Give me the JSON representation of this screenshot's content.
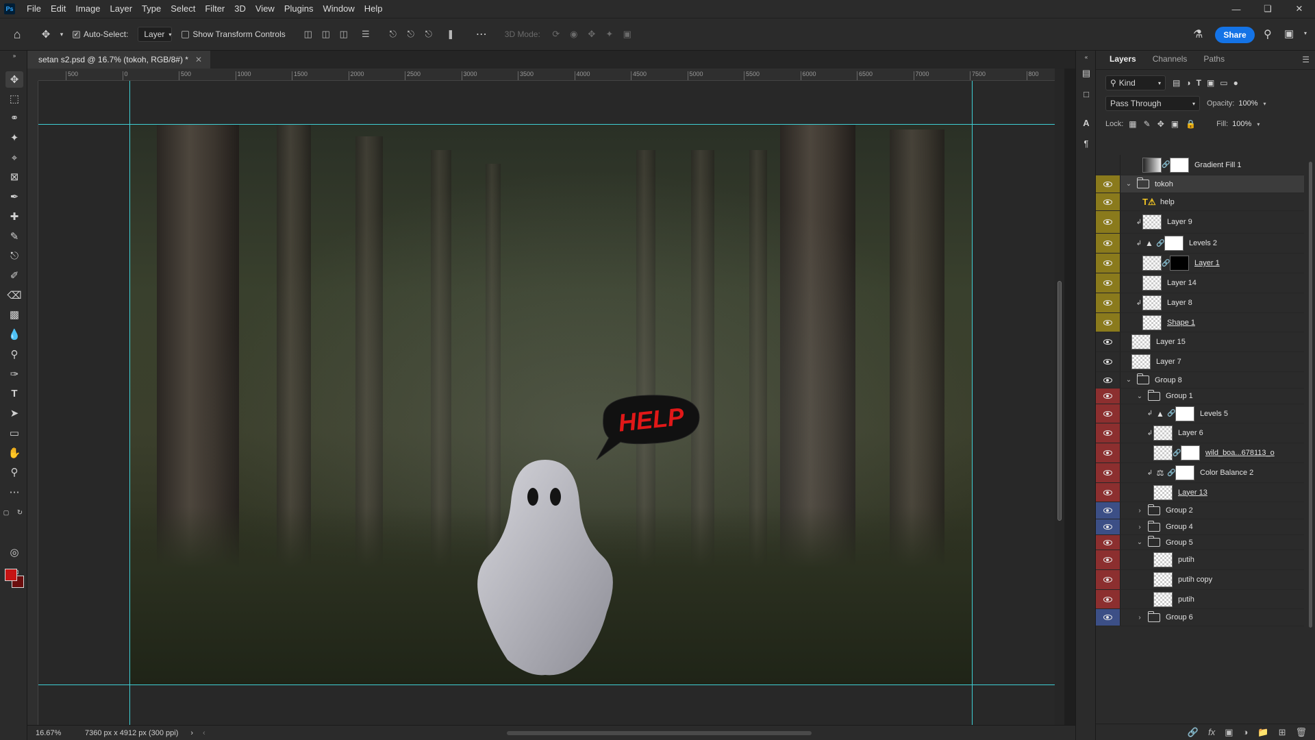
{
  "menubar": {
    "logo": "Ps",
    "items": [
      "File",
      "Edit",
      "Image",
      "Layer",
      "Type",
      "Select",
      "Filter",
      "3D",
      "View",
      "Plugins",
      "Window",
      "Help"
    ]
  },
  "options": {
    "auto_select_label": "Auto-Select:",
    "auto_select_value": "Layer",
    "show_transform_label": "Show Transform Controls",
    "mode_label": "3D Mode:",
    "share_label": "Share"
  },
  "document": {
    "tab_title": "setan s2.psd @ 16.7% (tokoh, RGB/8#) *",
    "artwork_text": "HELP"
  },
  "ruler": {
    "top_ticks": [
      "500",
      "0",
      "500",
      "1000",
      "1500",
      "2000",
      "2500",
      "3000",
      "3500",
      "4000",
      "4500",
      "5000",
      "5500",
      "6000",
      "6500",
      "7000",
      "7500",
      "800"
    ]
  },
  "status": {
    "zoom": "16.67%",
    "doc_info": "7360 px x 4912 px (300 ppi)"
  },
  "panel": {
    "tabs": [
      "Layers",
      "Channels",
      "Paths"
    ],
    "kind_filter": "Kind",
    "blend_mode": "Pass Through",
    "opacity_label": "Opacity:",
    "opacity_value": "100%",
    "lock_label": "Lock:",
    "fill_label": "Fill:",
    "fill_value": "100%"
  },
  "layers": [
    {
      "name": "Gradient Fill 1",
      "color": "none",
      "indent": 1,
      "type": "gradfill",
      "eye": false
    },
    {
      "name": "tokoh",
      "color": "yellow",
      "indent": 0,
      "type": "group-open",
      "selected": true
    },
    {
      "name": "help",
      "color": "yellow",
      "indent": 1,
      "type": "text"
    },
    {
      "name": "Layer 9",
      "color": "yellow",
      "indent": 1,
      "type": "pixel",
      "clip": true
    },
    {
      "name": "Levels 2",
      "color": "yellow",
      "indent": 1,
      "type": "levels",
      "clip": true,
      "mask": "white-blob"
    },
    {
      "name": "Layer 1",
      "color": "yellow",
      "indent": 1,
      "type": "pixel-mask",
      "mask": "black",
      "underline": true
    },
    {
      "name": "Layer 14",
      "color": "yellow",
      "indent": 1,
      "type": "pixel"
    },
    {
      "name": "Layer 8",
      "color": "yellow",
      "indent": 1,
      "type": "pixel",
      "clip": true
    },
    {
      "name": "Shape 1",
      "color": "yellow",
      "indent": 1,
      "type": "pixel",
      "underline": true
    },
    {
      "name": "Layer 15",
      "color": "none",
      "indent": 0,
      "type": "pixel"
    },
    {
      "name": "Layer 7",
      "color": "none",
      "indent": 0,
      "type": "pixel"
    },
    {
      "name": "Group 8",
      "color": "none",
      "indent": 0,
      "type": "group-open"
    },
    {
      "name": "Group 1",
      "color": "red",
      "indent": 1,
      "type": "group-open"
    },
    {
      "name": "Levels 5",
      "color": "red",
      "indent": 2,
      "type": "levels",
      "clip": true,
      "mask": "white"
    },
    {
      "name": "Layer 6",
      "color": "red",
      "indent": 2,
      "type": "pixel",
      "clip": true
    },
    {
      "name": "wild_boa...678113_o",
      "color": "red",
      "indent": 2,
      "type": "pixel-mask",
      "mask": "white",
      "underline": true
    },
    {
      "name": "Color Balance 2",
      "color": "red",
      "indent": 2,
      "type": "balance",
      "clip": true,
      "mask": "white"
    },
    {
      "name": "Layer 13",
      "color": "red",
      "indent": 2,
      "type": "pixel",
      "underline": true
    },
    {
      "name": "Group 2",
      "color": "blue",
      "indent": 1,
      "type": "group-closed"
    },
    {
      "name": "Group 4",
      "color": "blue",
      "indent": 1,
      "type": "group-closed"
    },
    {
      "name": "Group 5",
      "color": "red",
      "indent": 1,
      "type": "group-open"
    },
    {
      "name": "putih",
      "color": "red",
      "indent": 2,
      "type": "pixel"
    },
    {
      "name": "putih copy",
      "color": "red",
      "indent": 2,
      "type": "pixel"
    },
    {
      "name": "putih",
      "color": "red",
      "indent": 2,
      "type": "pixel"
    },
    {
      "name": "Group 6",
      "color": "blue",
      "indent": 1,
      "type": "group-closed"
    }
  ]
}
